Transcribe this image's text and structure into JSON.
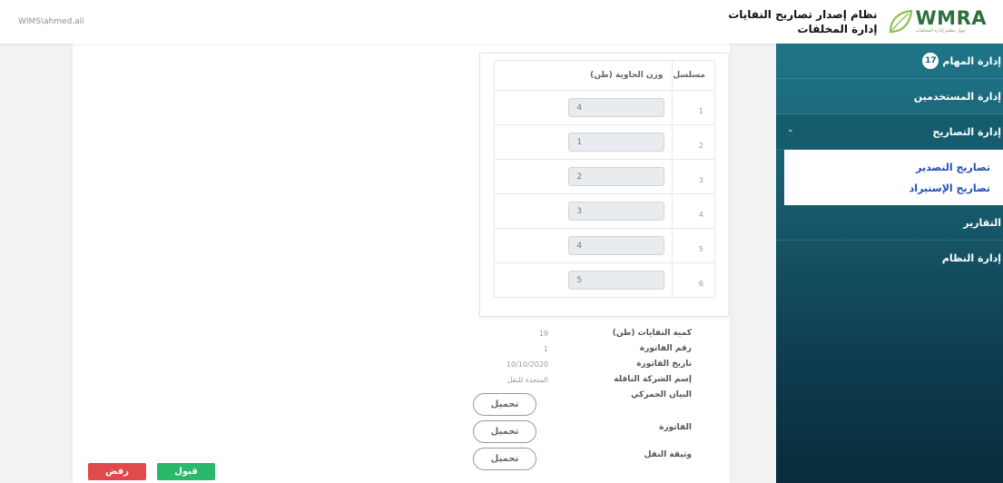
{
  "header": {
    "user": "WIMS\\ahmed.ali",
    "logo_text": "WMRA",
    "logo_subtext": "جهاز تنظيم إدارة المخلفات",
    "title_line1": "نظام إصدار تصاريح النفايات",
    "title_line2": "إدارة المخلفات"
  },
  "sidebar": {
    "tasks_label": "إدارة المهام",
    "tasks_count": "17",
    "users_label": "إدارة المستخدمين",
    "permits_label": "إدارة التصاريح",
    "permits_sub": [
      "تصاريح التصدير",
      "تصاريح الإستيراد"
    ],
    "reports_label": "التقارير",
    "system_label": "إدارة النظام"
  },
  "container_table": {
    "headers": [
      "مسلسل",
      "وزن الحاوية (طن)"
    ],
    "rows": [
      {
        "serial": "1",
        "weight": "4"
      },
      {
        "serial": "2",
        "weight": "1"
      },
      {
        "serial": "3",
        "weight": "2"
      },
      {
        "serial": "4",
        "weight": "3"
      },
      {
        "serial": "5",
        "weight": "4"
      },
      {
        "serial": "6",
        "weight": "5"
      }
    ]
  },
  "info": {
    "waste_qty_label": "كمية النفايات (طن)",
    "waste_qty_value": "19",
    "invoice_no_label": "رقم الفاتورة",
    "invoice_no_value": "1",
    "invoice_date_label": "تاريخ الفاتورة",
    "invoice_date_value": "10/10/2020",
    "carrier_label": "إسم الشركة الناقلة",
    "carrier_value": "المتحدة للنقل",
    "customs_label": "البيان الجمركي",
    "invoice_doc_label": "الفاتورة",
    "transport_doc_label": "وثيقة النقل",
    "download_label": "تحميل"
  },
  "actions": {
    "accept": "قبول",
    "reject": "رفض"
  },
  "colors": {
    "sidebar_top": "#1f7587",
    "sidebar_bottom": "#082c3b",
    "accept": "#29b96b",
    "reject": "#e04a4a",
    "logo": "#2e6f3f"
  }
}
